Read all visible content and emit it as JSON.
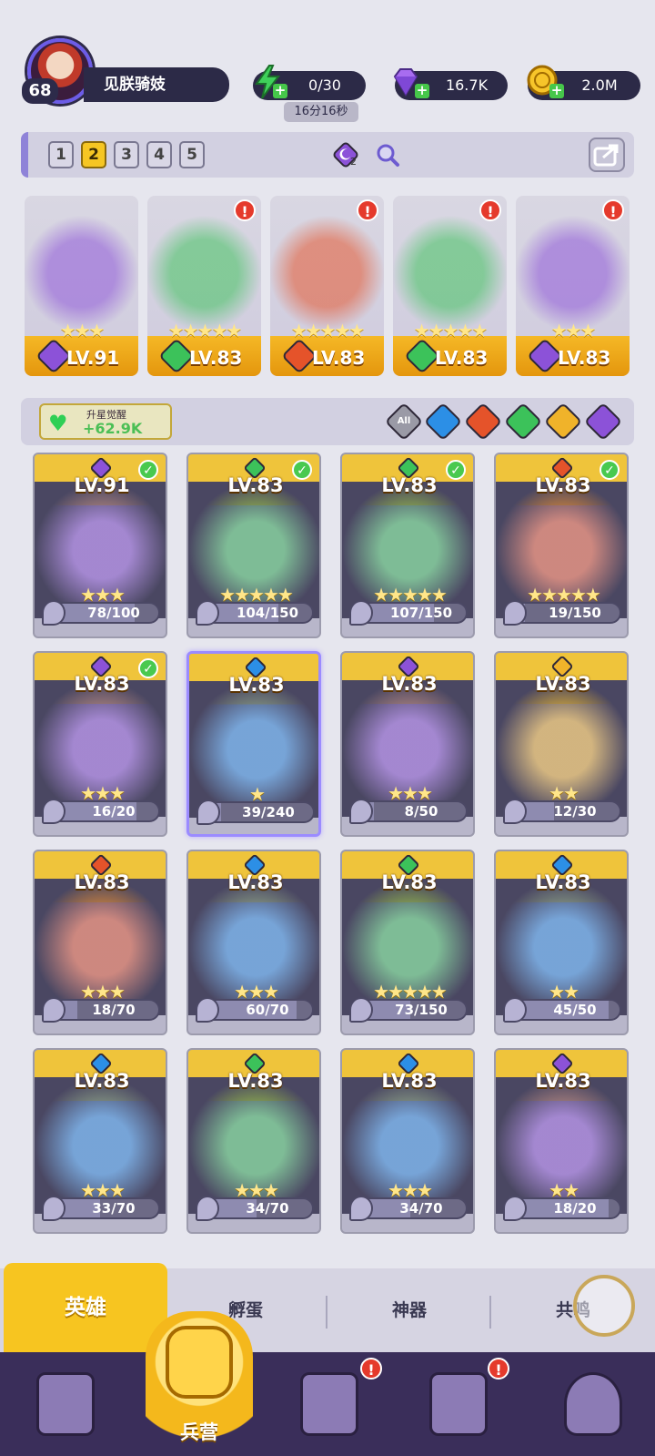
{
  "player": {
    "level": "68",
    "name": "见朕骑妓"
  },
  "resources": {
    "energy": {
      "value": "0/30",
      "timer": "16分16秒",
      "icon": "lightning-icon"
    },
    "gems": {
      "value": "16.7K",
      "icon": "diamond-icon"
    },
    "gold": {
      "value": "2.0M",
      "icon": "coin-icon"
    }
  },
  "team_tabs": [
    "1",
    "2",
    "3",
    "4",
    "5"
  ],
  "team_tab_active": "2",
  "team_badge_count": "2",
  "element_colors": {
    "dark": "#8c52d8",
    "nature": "#3cc25a",
    "fire": "#e5532a",
    "water": "#2c8fe6",
    "light": "#f0b32a"
  },
  "team": [
    {
      "level": "LV.91",
      "stars": "★★★",
      "element": "dark",
      "alert": false
    },
    {
      "level": "LV.83",
      "stars": "★★★★★",
      "element": "nature",
      "alert": true
    },
    {
      "level": "LV.83",
      "stars": "★★★★★",
      "element": "fire",
      "alert": true
    },
    {
      "level": "LV.83",
      "stars": "★★★★★",
      "element": "nature",
      "alert": true
    },
    {
      "level": "LV.83",
      "stars": "★★★",
      "element": "dark",
      "alert": true
    }
  ],
  "awaken": {
    "label": "升星觉醒",
    "value": "+62.9K"
  },
  "filters": {
    "all_label": "All",
    "elements": [
      "water",
      "fire",
      "nature",
      "light",
      "dark"
    ]
  },
  "heroes": [
    {
      "level": "LV.91",
      "element": "dark",
      "check": true,
      "stars": "★★★",
      "shards": "78/100",
      "progress": 0.78
    },
    {
      "level": "LV.83",
      "element": "nature",
      "check": true,
      "stars": "★★★★★",
      "shards": "104/150",
      "progress": 0.69
    },
    {
      "level": "LV.83",
      "element": "nature",
      "check": true,
      "stars": "★★★★★",
      "shards": "107/150",
      "progress": 0.71
    },
    {
      "level": "LV.83",
      "element": "fire",
      "check": true,
      "stars": "★★★★★",
      "shards": "19/150",
      "progress": 0.13
    },
    {
      "level": "LV.83",
      "element": "dark",
      "check": true,
      "stars": "★★★",
      "shards": "16/20",
      "progress": 0.8
    },
    {
      "level": "LV.83",
      "element": "water",
      "check": false,
      "stars": "★",
      "shards": "39/240",
      "progress": 0.16,
      "selected": true
    },
    {
      "level": "LV.83",
      "element": "dark",
      "check": false,
      "stars": "★★★",
      "shards": "8/50",
      "progress": 0.16
    },
    {
      "level": "LV.83",
      "element": "light",
      "check": false,
      "stars": "★★",
      "shards": "12/30",
      "progress": 0.4
    },
    {
      "level": "LV.83",
      "element": "fire",
      "check": false,
      "stars": "★★★",
      "shards": "18/70",
      "progress": 0.26
    },
    {
      "level": "LV.83",
      "element": "water",
      "check": false,
      "stars": "★★★",
      "shards": "60/70",
      "progress": 0.86
    },
    {
      "level": "LV.83",
      "element": "nature",
      "check": false,
      "stars": "★★★★★",
      "shards": "73/150",
      "progress": 0.49
    },
    {
      "level": "LV.83",
      "element": "water",
      "check": false,
      "stars": "★★",
      "shards": "45/50",
      "progress": 0.9
    },
    {
      "level": "LV.83",
      "element": "water",
      "check": false,
      "stars": "★★★",
      "shards": "33/70",
      "progress": 0.47
    },
    {
      "level": "LV.83",
      "element": "nature",
      "check": false,
      "stars": "★★★",
      "shards": "34/70",
      "progress": 0.49
    },
    {
      "level": "LV.83",
      "element": "water",
      "check": false,
      "stars": "★★★",
      "shards": "34/70",
      "progress": 0.49
    },
    {
      "level": "LV.83",
      "element": "dark",
      "check": false,
      "stars": "★★",
      "shards": "18/20",
      "progress": 0.9
    }
  ],
  "bottom_tabs": [
    "英雄",
    "孵蛋",
    "神器",
    "共鸣"
  ],
  "bottom_tab_active": "英雄",
  "nav": {
    "items": [
      {
        "icon": "cards-icon",
        "alert": false
      },
      {
        "icon": "map-icon",
        "alert": true
      },
      {
        "icon": "castle-icon",
        "alert": true
      },
      {
        "icon": "mushroom-icon",
        "alert": false
      }
    ],
    "center_label": "兵营",
    "center_icon": "barracks-icon"
  }
}
